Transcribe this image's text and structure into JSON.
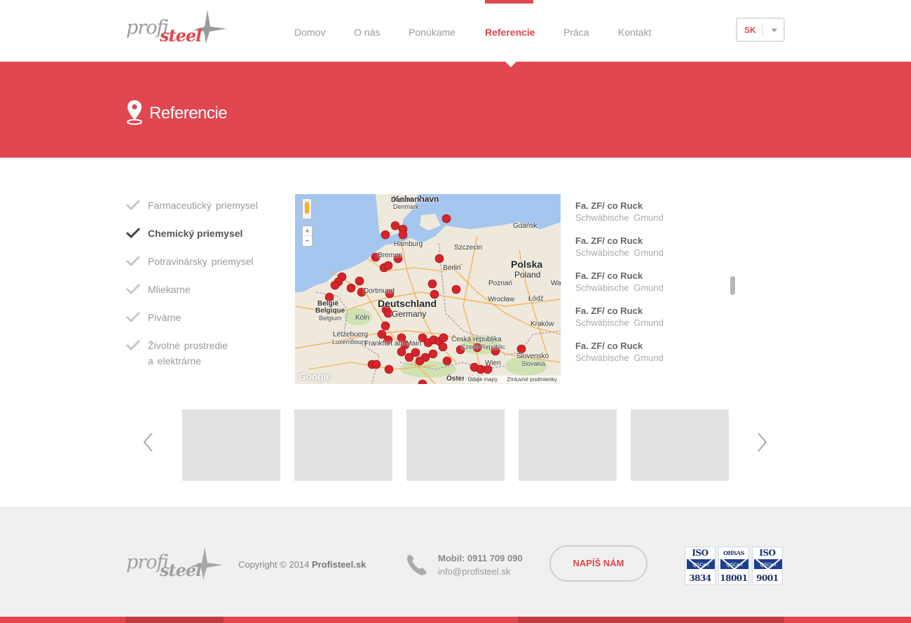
{
  "brand": {
    "logo_word1": "profi",
    "logo_word2": "steel",
    "accent_color": "#e0474f"
  },
  "nav": {
    "items": [
      {
        "label": "Domov"
      },
      {
        "label": "O nás"
      },
      {
        "label": "Ponúkame"
      },
      {
        "label": "Referencie",
        "active": true
      },
      {
        "label": "Práca"
      },
      {
        "label": "Kontakt"
      }
    ]
  },
  "language": {
    "selected": "SK",
    "icon": "chevron-down-icon"
  },
  "banner": {
    "title": "Referencie",
    "icon": "map-pin-icon"
  },
  "categories": [
    {
      "label": "Farmaceutický priemysel",
      "active": false
    },
    {
      "label": "Chemický priemysel",
      "active": true
    },
    {
      "label": "Potravinársky priemysel",
      "active": false
    },
    {
      "label": "Mliekarne",
      "active": false
    },
    {
      "label": "Pivárne",
      "active": false
    },
    {
      "label": "Životné prostredie",
      "label2": "a elektrárne",
      "active": false
    }
  ],
  "map": {
    "labels": {
      "danmark": "Danmark",
      "denmark": "Denmark",
      "kobenhavn": "København",
      "hamburg": "Hamburg",
      "szczecin": "Szczecin",
      "gdansk": "Gdańsk",
      "polska": "Polska",
      "poland": "Poland",
      "berlin": "Berlin",
      "poznan": "Poznań",
      "bremen": "Bremen",
      "dortmund": "Dortmund",
      "deutschland": "Deutschland",
      "germany": "Germany",
      "wroclaw": "Wrocław",
      "lodz": "Łódź",
      "belgie": "België",
      "belgique": "Belgique",
      "belgium": "Belgium",
      "koln": "Köln",
      "letzebuerg": "Lëtzebuerg",
      "luxembourg": "Luxembourg",
      "frankfurt": "Frankfurt am Main",
      "ceska": "Česká republika",
      "czech": "Czech Republic",
      "krakow": "Kraków",
      "slovensko": "Slovensko",
      "slovakia": "Slovakia",
      "wien": "Wien",
      "osterreich": "Österreich",
      "warszawa": "Warszawa"
    },
    "google": "Google",
    "map_data_text": "Údaje mapy",
    "terms_text": "Zmluvné podmienky",
    "zoom_in": "+",
    "zoom_out": "−"
  },
  "references": [
    {
      "company": "Fa. ZF/ co Ruck",
      "city": "Schwäbische Gmund"
    },
    {
      "company": "Fa. ZF/ co Ruck",
      "city": "Schwäbische Gmund"
    },
    {
      "company": "Fa. ZF/ co Ruck",
      "city": "Schwäbische Gmund"
    },
    {
      "company": "Fa. ZF/ co Ruck",
      "city": "Schwäbische Gmund"
    },
    {
      "company": "Fa. ZF/ co Ruck",
      "city": "Schwäbische Gmund"
    }
  ],
  "carousel": {
    "prev_icon": "chevron-left-icon",
    "next_icon": "chevron-right-icon",
    "thumb_count": 5
  },
  "footer": {
    "copyright_prefix": "Copyright © 2014 ",
    "copyright_brand": "Profisteel.sk",
    "mobile": "Mobil: 0911 709 090",
    "email": "info@profisteel.sk",
    "write_button": "NAPÍŠ NÁM",
    "certs": [
      {
        "top": "ISO",
        "badge": "QSCert",
        "bottom": "3834"
      },
      {
        "top": "OHSAS",
        "badge": "QSCert",
        "bottom": "18001"
      },
      {
        "top": "ISO",
        "badge": "QSCert",
        "bottom": "9001"
      }
    ]
  }
}
